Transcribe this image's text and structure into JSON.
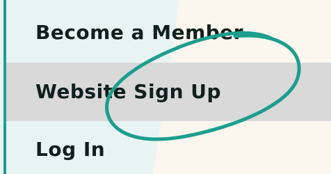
{
  "menu": {
    "items": [
      {
        "label": "Become a Member",
        "highlighted": false
      },
      {
        "label": "Website Sign Up",
        "highlighted": true
      },
      {
        "label": "Log In",
        "highlighted": false
      }
    ]
  },
  "colors": {
    "accent": "#1c9e8e",
    "page_background": "#fbf6ee",
    "left_pane_tint": "#e8f4f3",
    "highlight_row": "#d9d9d9",
    "text": "#0f1f1c"
  },
  "annotation": {
    "shape": "hand-drawn-ellipse",
    "color": "#1c9e8e"
  }
}
